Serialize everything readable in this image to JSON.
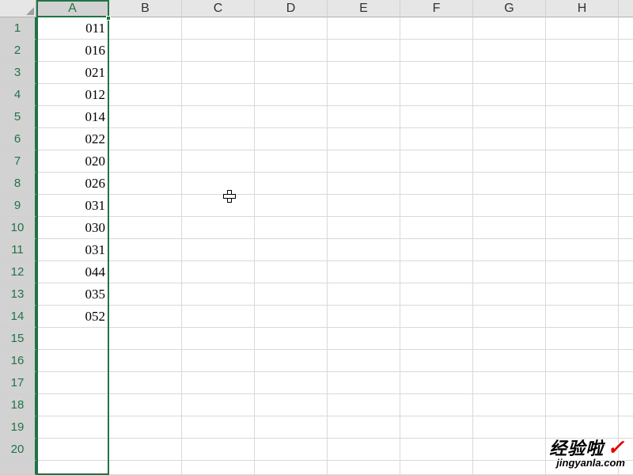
{
  "columns": [
    "A",
    "B",
    "C",
    "D",
    "E",
    "F",
    "G",
    "H"
  ],
  "selected_column_index": 0,
  "active_cell": {
    "row": 1,
    "col": "A"
  },
  "row_count": 20,
  "data": {
    "A": [
      "011",
      "016",
      "021",
      "012",
      "014",
      "022",
      "020",
      "026",
      "031",
      "030",
      "031",
      "044",
      "035",
      "052"
    ]
  },
  "watermark": {
    "title": "经验啦",
    "check": "✓",
    "subtitle": "jingyanla.com"
  }
}
